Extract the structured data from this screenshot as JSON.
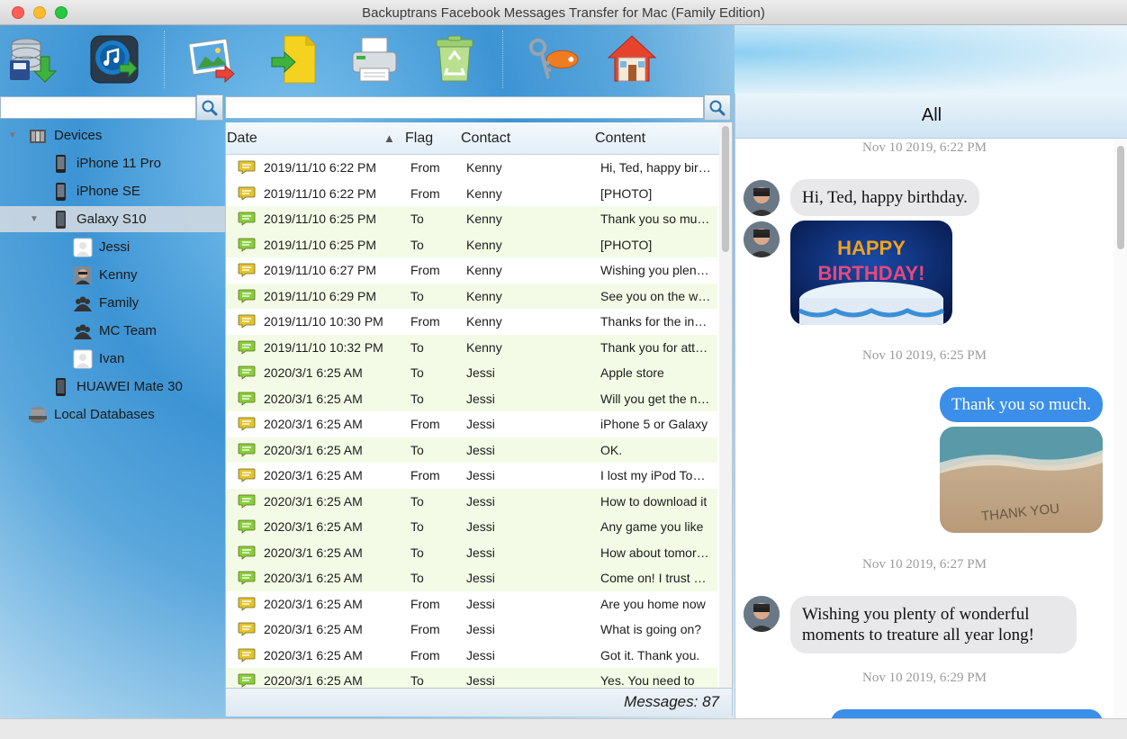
{
  "window": {
    "title": "Backuptrans Facebook Messages Transfer for Mac (Family Edition)"
  },
  "toolbar": {
    "buttons": [
      {
        "icon": "backup-database-icon"
      },
      {
        "icon": "itunes-transfer-icon"
      },
      {
        "icon": "export-photo-icon"
      },
      {
        "icon": "import-file-icon"
      },
      {
        "icon": "printer-icon"
      },
      {
        "icon": "recycle-bin-icon"
      },
      {
        "icon": "key-icon"
      },
      {
        "icon": "home-icon"
      }
    ]
  },
  "search": {
    "left_value": "",
    "middle_value": ""
  },
  "tree": {
    "devices": "Devices",
    "iphone11": "iPhone 11 Pro",
    "iphonese": "iPhone SE",
    "galaxy": "Galaxy S10",
    "jessi": "Jessi",
    "kenny": "Kenny",
    "family": "Family",
    "mcteam": "MC Team",
    "ivan": "Ivan",
    "huawei": "HUAWEI Mate 30",
    "localdb": "Local Databases"
  },
  "list": {
    "columns": {
      "date": "Date",
      "flag": "Flag",
      "contact": "Contact",
      "content": "Content"
    },
    "sort_indicator": "▲",
    "rows": [
      {
        "date": "2019/11/10 6:22 PM",
        "flag": "From",
        "contact": "Kenny",
        "content": "Hi, Ted, happy birthday."
      },
      {
        "date": "2019/11/10 6:22 PM",
        "flag": "From",
        "contact": "Kenny",
        "content": "[PHOTO]"
      },
      {
        "date": "2019/11/10 6:25 PM",
        "flag": "To",
        "contact": "Kenny",
        "content": "Thank you so much."
      },
      {
        "date": "2019/11/10 6:25 PM",
        "flag": "To",
        "contact": "Kenny",
        "content": "[PHOTO]"
      },
      {
        "date": "2019/11/10 6:27 PM",
        "flag": "From",
        "contact": "Kenny",
        "content": "Wishing you plenty of wonderful moments"
      },
      {
        "date": "2019/11/10 6:29 PM",
        "flag": "To",
        "contact": "Kenny",
        "content": "See you on the weekend"
      },
      {
        "date": "2019/11/10 10:30 PM",
        "flag": "From",
        "contact": "Kenny",
        "content": "Thanks for the invitation"
      },
      {
        "date": "2019/11/10 10:32 PM",
        "flag": "To",
        "contact": "Kenny",
        "content": "Thank you for attending"
      },
      {
        "date": "2020/3/1 6:25 AM",
        "flag": "To",
        "contact": "Jessi",
        "content": "Apple store"
      },
      {
        "date": "2020/3/1 6:25 AM",
        "flag": "To",
        "contact": "Jessi",
        "content": "Will you get the new one"
      },
      {
        "date": "2020/3/1 6:25 AM",
        "flag": "From",
        "contact": "Jessi",
        "content": "iPhone 5 or Galaxy"
      },
      {
        "date": "2020/3/1 6:25 AM",
        "flag": "To",
        "contact": "Jessi",
        "content": "OK."
      },
      {
        "date": "2020/3/1 6:25 AM",
        "flag": "From",
        "contact": "Jessi",
        "content": "I lost my iPod Touch"
      },
      {
        "date": "2020/3/1 6:25 AM",
        "flag": "To",
        "contact": "Jessi",
        "content": "How to download it"
      },
      {
        "date": "2020/3/1 6:25 AM",
        "flag": "To",
        "contact": "Jessi",
        "content": "Any game you like"
      },
      {
        "date": "2020/3/1 6:25 AM",
        "flag": "To",
        "contact": "Jessi",
        "content": "How about tomorrow"
      },
      {
        "date": "2020/3/1 6:25 AM",
        "flag": "To",
        "contact": "Jessi",
        "content": "Come on! I trust you"
      },
      {
        "date": "2020/3/1 6:25 AM",
        "flag": "From",
        "contact": "Jessi",
        "content": "Are you home now"
      },
      {
        "date": "2020/3/1 6:25 AM",
        "flag": "From",
        "contact": "Jessi",
        "content": "What is going on?"
      },
      {
        "date": "2020/3/1 6:25 AM",
        "flag": "From",
        "contact": "Jessi",
        "content": "Got it. Thank you."
      },
      {
        "date": "2020/3/1 6:25 AM",
        "flag": "To",
        "contact": "Jessi",
        "content": "Yes. You need to"
      }
    ],
    "footer": "Messages: 87"
  },
  "conversation": {
    "header": "All",
    "ts1": "Nov 10 2019, 6:22 PM",
    "msg1": "Hi, Ted, happy birthday.",
    "ts2": "Nov 10 2019, 6:25 PM",
    "msg2": "Thank you so much.",
    "ts3": "Nov 10 2019, 6:27 PM",
    "msg3_line1": "Wishing you plenty of wonderful",
    "msg3_line2": "moments to treature all year long!",
    "ts4": "Nov 10 2019, 6:29 PM",
    "photo1_text": "HAPPY BIRTHDAY!",
    "photo2_text": "THANK YOU"
  },
  "colors": {
    "accent_blue": "#3b8fe8",
    "row_alt": "#f3fbe6",
    "from_icon": "#e4c32c",
    "to_icon": "#86cf3a"
  }
}
